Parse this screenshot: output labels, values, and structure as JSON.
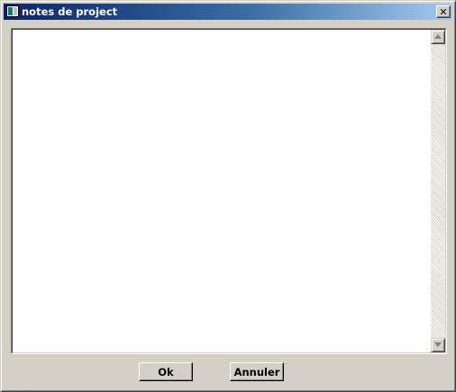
{
  "window": {
    "title": "notes de project",
    "close_symbol": "✕",
    "icon": "app-window-icon"
  },
  "notes": {
    "value": "",
    "placeholder": ""
  },
  "scrollbar": {
    "up_icon": "arrow-up-icon",
    "down_icon": "arrow-down-icon"
  },
  "buttons": {
    "ok_label": "Ok",
    "cancel_label": "Annuler"
  },
  "colors": {
    "titlebar_start": "#0a246a",
    "titlebar_end": "#a6caf0",
    "face": "#d4d0c8"
  }
}
